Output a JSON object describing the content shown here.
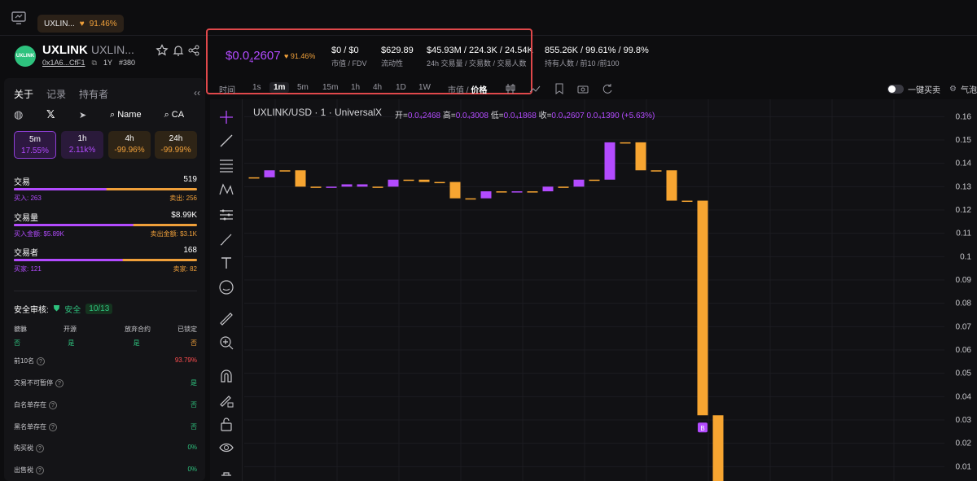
{
  "top_tab": {
    "label": "UXLIN...",
    "pct": "91.46%"
  },
  "token": {
    "name": "UXLINK",
    "sub": "UXLIN...",
    "logo_text": "UXLINK",
    "address": "0x1A6...CfF1",
    "age": "1Y",
    "rank": "#380"
  },
  "stats": {
    "price_prefix": "$0.0",
    "price_sub": "4",
    "price_rest": "2607",
    "price_change": "91.46%",
    "mcap": {
      "value": "$0 / $0",
      "label": "市值 / FDV"
    },
    "liquidity": {
      "value": "$629.89",
      "label": "流动性"
    },
    "volume": {
      "value": "$45.93M / 224.3K / 24.54K",
      "label": "24h 交易量 / 交易数 / 交易人数"
    },
    "holders": {
      "value": "855.26K / 99.61% / 99.8%",
      "label": "持有人数 / 前10 /前100"
    }
  },
  "timeframes": [
    "时间",
    "1s",
    "1m",
    "5m",
    "15m",
    "1h",
    "4h",
    "1D",
    "1W"
  ],
  "active_timeframe": "1m",
  "view_toggle": {
    "a": "市值",
    "sep": "/",
    "b": "价格"
  },
  "one_click": "一键买卖",
  "weather": "气泡",
  "sidebar": {
    "tabs": [
      "关于",
      "记录",
      "持有者"
    ],
    "collapse": "‹‹",
    "name_btn": "Name",
    "ca_btn": "CA",
    "periods": [
      {
        "label": "5m",
        "pct": "17.55%"
      },
      {
        "label": "1h",
        "pct": "2.11k%"
      },
      {
        "label": "4h",
        "pct": "-99.96%"
      },
      {
        "label": "24h",
        "pct": "-99.99%"
      }
    ],
    "trades": {
      "label": "交易",
      "value": "519",
      "buy": "买入: 263",
      "sell": "卖出: 256",
      "buy_ratio": 0.507
    },
    "volume": {
      "label": "交易量",
      "value": "$8.99K",
      "buy": "买入金额: $5.89K",
      "sell": "卖出金额: $3.1K",
      "buy_ratio": 0.655
    },
    "traders": {
      "label": "交易者",
      "value": "168",
      "buy": "买家: 121",
      "sell": "卖家: 82",
      "buy_ratio": 0.596
    },
    "security": {
      "title": "安全审核:",
      "status": "安全",
      "score": "10/13",
      "headers": [
        "貔貅",
        "开源",
        "放弃合约",
        "已锁定"
      ],
      "values": [
        "否",
        "是",
        "是",
        "否"
      ],
      "items": [
        {
          "label": "前10名",
          "value": "93.79%"
        },
        {
          "label": "交易不可暂停",
          "value": "是"
        },
        {
          "label": "白名单存在",
          "value": "否"
        },
        {
          "label": "黑名单存在",
          "value": "否"
        },
        {
          "label": "购买税",
          "value": "0%"
        },
        {
          "label": "出售税",
          "value": "0%"
        }
      ]
    }
  },
  "chart": {
    "symbol": "UXLINK/USD · 1 · UniversalX",
    "ohlc": {
      "open_label": "开=",
      "open": "0.0₄2468",
      "high_label": "高=",
      "high": "0.0₄3008",
      "low_label": "低=",
      "low": "0.0₄1868",
      "close_label": "收=",
      "close": "0.0₄2607",
      "change": "0.0₄1390 (+5.63%)"
    },
    "marker": "B"
  },
  "chart_data": {
    "type": "candlestick",
    "y_ticks": [
      0.16,
      0.15,
      0.14,
      0.13,
      0.12,
      0.11,
      0.1,
      0.09,
      0.08,
      0.07,
      0.06,
      0.05,
      0.04,
      0.03,
      0.02,
      0.01
    ],
    "ylim": [
      0.0,
      0.165
    ],
    "candles": [
      {
        "o": 0.134,
        "c": 0.134,
        "dir": "flat"
      },
      {
        "o": 0.134,
        "c": 0.137,
        "dir": "up"
      },
      {
        "o": 0.137,
        "c": 0.137,
        "dir": "flat"
      },
      {
        "o": 0.137,
        "c": 0.13,
        "dir": "down"
      },
      {
        "o": 0.13,
        "c": 0.13,
        "dir": "flat"
      },
      {
        "o": 0.13,
        "c": 0.13,
        "dir": "flat"
      },
      {
        "o": 0.13,
        "c": 0.131,
        "dir": "up"
      },
      {
        "o": 0.131,
        "c": 0.13,
        "dir": "flat"
      },
      {
        "o": 0.13,
        "c": 0.13,
        "dir": "flat"
      },
      {
        "o": 0.13,
        "c": 0.133,
        "dir": "up"
      },
      {
        "o": 0.133,
        "c": 0.133,
        "dir": "flat"
      },
      {
        "o": 0.133,
        "c": 0.132,
        "dir": "down"
      },
      {
        "o": 0.132,
        "c": 0.132,
        "dir": "flat"
      },
      {
        "o": 0.132,
        "c": 0.125,
        "dir": "down"
      },
      {
        "o": 0.125,
        "c": 0.125,
        "dir": "flat"
      },
      {
        "o": 0.125,
        "c": 0.128,
        "dir": "up"
      },
      {
        "o": 0.128,
        "c": 0.128,
        "dir": "flat"
      },
      {
        "o": 0.128,
        "c": 0.128,
        "dir": "flat"
      },
      {
        "o": 0.128,
        "c": 0.128,
        "dir": "flat"
      },
      {
        "o": 0.128,
        "c": 0.13,
        "dir": "up"
      },
      {
        "o": 0.13,
        "c": 0.13,
        "dir": "flat"
      },
      {
        "o": 0.13,
        "c": 0.133,
        "dir": "up"
      },
      {
        "o": 0.133,
        "c": 0.133,
        "dir": "flat"
      },
      {
        "o": 0.133,
        "c": 0.149,
        "dir": "up"
      },
      {
        "o": 0.149,
        "c": 0.149,
        "dir": "flat"
      },
      {
        "o": 0.149,
        "c": 0.137,
        "dir": "down"
      },
      {
        "o": 0.137,
        "c": 0.137,
        "dir": "flat"
      },
      {
        "o": 0.137,
        "c": 0.124,
        "dir": "down"
      },
      {
        "o": 0.124,
        "c": 0.124,
        "dir": "flat"
      },
      {
        "o": 0.124,
        "c": 0.032,
        "dir": "down"
      },
      {
        "o": 0.032,
        "c": 0.0,
        "dir": "down"
      }
    ]
  }
}
